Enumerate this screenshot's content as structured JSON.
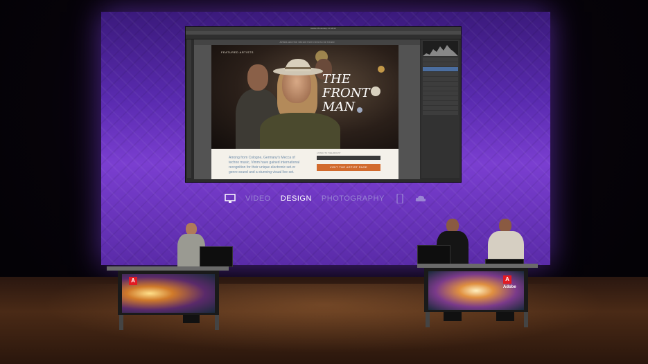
{
  "presentation_screen": {
    "photoshop_window": {
      "title": "Adobe Photoshop CC 2014",
      "doc_caption": "Artists and the vibrant their need to be heard",
      "featured_label": "FEATURED ARTISTS",
      "hero_title_lines": [
        "THE",
        "FRONT",
        "MAN"
      ],
      "body_text": "Among from Cologne, Germany's Mecca of techno music, Vimm have gained international recognition for their unique electronic set-or genre sound and a stunning visual live set.",
      "player_label": "LISTEN TO \"DELIRIOUS\"",
      "visit_button": "VISIT THE ARTIST PAGE"
    },
    "categories": [
      {
        "label": "VIDEO",
        "active": false
      },
      {
        "label": "DESIGN",
        "active": true
      },
      {
        "label": "PHOTOGRAPHY",
        "active": false
      }
    ],
    "icons": [
      "monitor-icon",
      "mobile-icon",
      "cloud-icon"
    ]
  },
  "podiums": {
    "left_brand": "Adobe",
    "right_brand": "Adobe"
  },
  "colors": {
    "screen_purple": "#5a2bb0",
    "accent_orange": "#d26b2e",
    "adobe_red": "#e21b23"
  }
}
